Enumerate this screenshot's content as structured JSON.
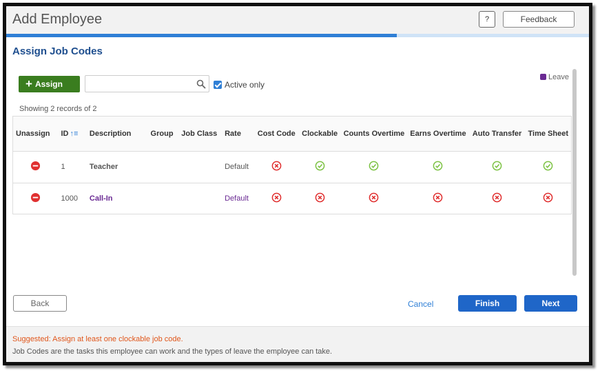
{
  "header": {
    "title": "Add Employee",
    "help_label": "?",
    "feedback_label": "Feedback"
  },
  "progress": {
    "fraction": 0.67
  },
  "section": {
    "title": "Assign Job Codes"
  },
  "legend": {
    "label": "Leave"
  },
  "toolbar": {
    "assign_label": "Assign",
    "search_value": "",
    "search_placeholder": "",
    "active_only_label": "Active only",
    "active_only_checked": true
  },
  "records": {
    "showing_text": "Showing 2 records of 2"
  },
  "table": {
    "columns": [
      "Unassign",
      "ID",
      "Description",
      "Group",
      "Job Class",
      "Rate",
      "Cost Code",
      "Clockable",
      "Counts Overtime",
      "Earns Overtime",
      "Auto Transfer",
      "Time Sheet"
    ],
    "rows": [
      {
        "id": "1",
        "description": "Teacher",
        "group": "",
        "job_class": "",
        "rate": "Default",
        "is_leave": false,
        "cost_code": false,
        "clockable": true,
        "counts_overtime": true,
        "earns_overtime": true,
        "auto_transfer": true,
        "time_sheet": true
      },
      {
        "id": "1000",
        "description": "Call-In",
        "group": "",
        "job_class": "",
        "rate": "Default",
        "is_leave": true,
        "cost_code": false,
        "clockable": false,
        "counts_overtime": false,
        "earns_overtime": false,
        "auto_transfer": false,
        "time_sheet": false
      }
    ]
  },
  "actions": {
    "back_label": "Back",
    "cancel_label": "Cancel",
    "finish_label": "Finish",
    "next_label": "Next"
  },
  "footer": {
    "suggestion": "Suggested: Assign at least one clockable job code.",
    "note": "Job Codes are the tasks this employee can work and the types of leave the employee can take."
  },
  "colors": {
    "accent": "#1f66c8",
    "assign_green": "#3a7d1f",
    "yes_green": "#7cc243",
    "no_red": "#e03030",
    "leave_purple": "#6a2a93",
    "warning_orange": "#e0561b"
  },
  "icons": {
    "yes": "check-circle-icon",
    "no": "x-circle-icon",
    "unassign": "minus-circle-icon",
    "search": "search-icon",
    "sort": "sort-ascending-icon"
  }
}
